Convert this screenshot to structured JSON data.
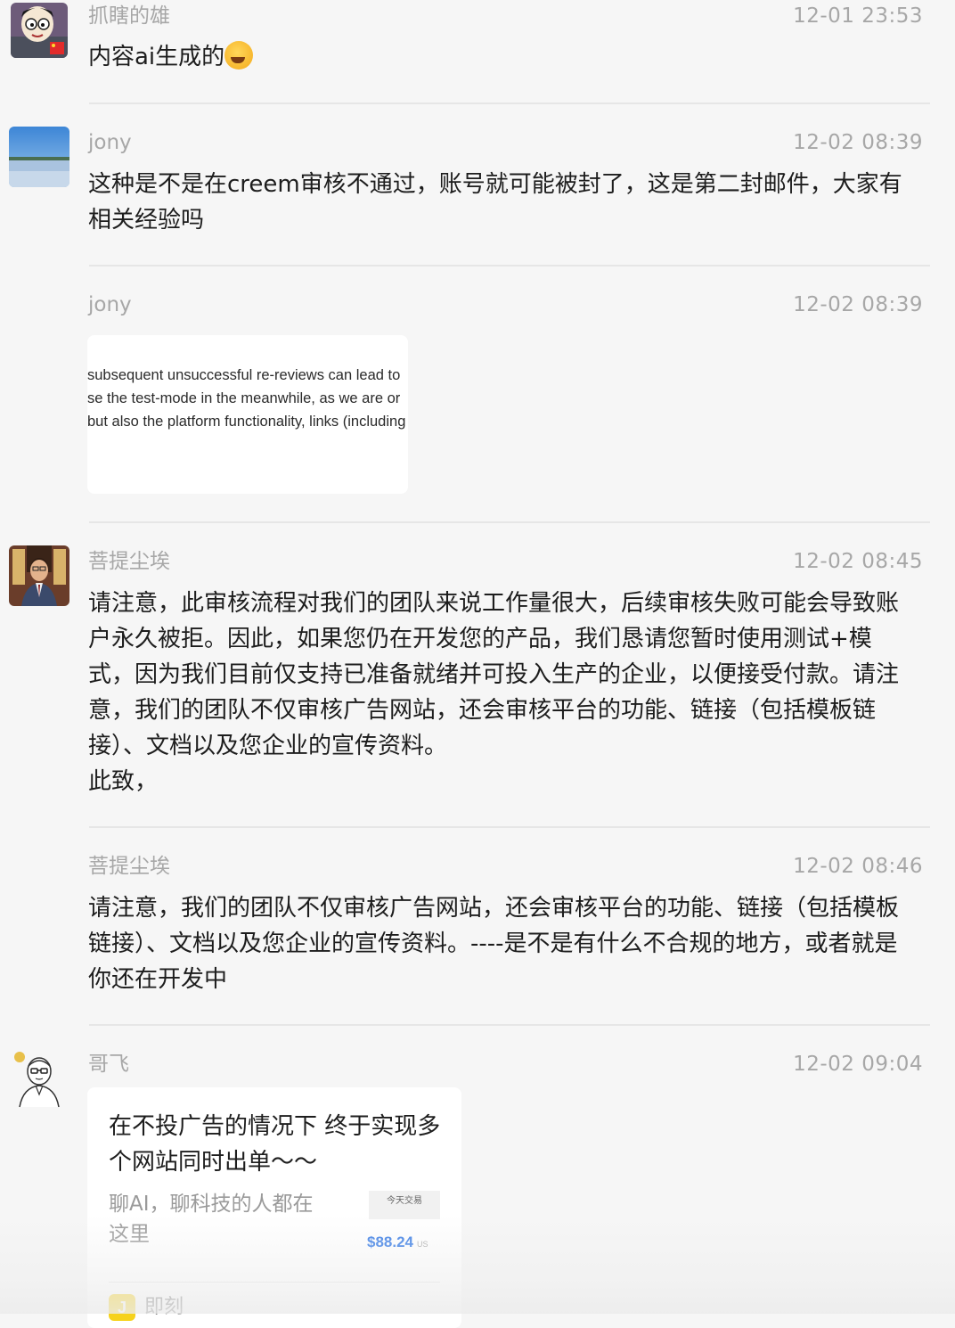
{
  "messages": [
    {
      "name": "抓瞎的雄",
      "time": "12-01 23:53",
      "text": "内容ai生成的",
      "emoji": "crying-laughing-emoji"
    },
    {
      "name": "jony",
      "time": "12-02 08:39",
      "text": "这种是不是在creem审核不通过，账号就可能被封了，这是第二封邮件，大家有相关经验吗"
    },
    {
      "name": "jony",
      "time": "12-02 08:39",
      "image_lines": [
        "subsequent unsuccessful re-reviews can lead to",
        "se the test-mode in the meanwhile, as we are or",
        "but also the platform functionality, links (including"
      ]
    },
    {
      "name": "菩提尘埃",
      "time": "12-02 08:45",
      "text": "请注意，此审核流程对我们的团队来说工作量很大，后续审核失败可能会导致账户永久被拒。因此，如果您仍在开发您的产品，我们恳请您暂时使用测试+模式，因为我们目前仅支持已准备就绪并可投入生产的企业，以便接受付款。请注意，我们的团队不仅审核广告网站，还会审核平台的功能、链接（包括模板链接）、文档以及您企业的宣传资料。\n此致，"
    },
    {
      "name": "菩提尘埃",
      "time": "12-02 08:46",
      "text": "请注意，我们的团队不仅审核广告网站，还会审核平台的功能、链接（包括模板链接）、文档以及您企业的宣传资料。----是不是有什么不合规的地方，或者就是你还在开发中"
    },
    {
      "name": "哥飞",
      "time": "12-02 09:04",
      "link": {
        "title": "在不投广告的情况下 终于实现多个网站同时出单～～",
        "description": "聊AI，聊科技的人都在这里",
        "thumb_header": "今天交易",
        "thumb_amount": "$88.24",
        "thumb_unit": "US",
        "source_icon": "J",
        "source": "即刻"
      }
    }
  ]
}
